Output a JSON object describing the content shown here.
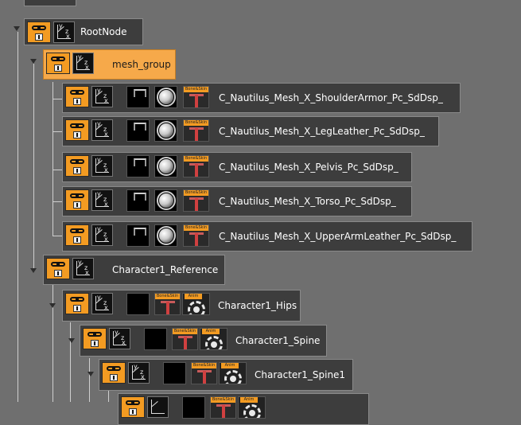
{
  "tree": {
    "root": {
      "label": "RootNode"
    },
    "mesh_group": {
      "label": "mesh_group"
    },
    "meshes": [
      {
        "label": "C_Nautilus_Mesh_X_ShoulderArmor_Pc_SdDsp_",
        "tag": "Bone&Skin"
      },
      {
        "label": "C_Nautilus_Mesh_X_LegLeather_Pc_SdDsp_",
        "tag": "Bone&Skin"
      },
      {
        "label": "C_Nautilus_Mesh_X_Pelvis_Pc_SdDsp_",
        "tag": "Bone&Skin"
      },
      {
        "label": "C_Nautilus_Mesh_X_Torso_Pc_SdDsp_",
        "tag": "Bone&Skin"
      },
      {
        "label": "C_Nautilus_Mesh_X_UpperArmLeather_Pc_SdDsp_",
        "tag": "Bone&Skin"
      }
    ],
    "reference": {
      "label": "Character1_Reference"
    },
    "joints": [
      {
        "label": "Character1_Hips",
        "tag_bone": "Bone&Skin",
        "tag_anim": "Anim"
      },
      {
        "label": "Character1_Spine",
        "tag_bone": "Bone&Skin",
        "tag_anim": "Anim"
      },
      {
        "label": "Character1_Spine1",
        "tag_bone": "Bone&Skin",
        "tag_anim": "Anim"
      },
      {
        "label": "",
        "tag_bone": "Bone&Skin",
        "tag_anim": "Anim"
      }
    ],
    "axis_labels": {
      "y": "y",
      "z": "z",
      "x": "x"
    }
  },
  "colors": {
    "background": "#6f6f6f",
    "node": "#3d3d3d",
    "selected": "#f6a94a",
    "accent": "#f39b22"
  }
}
